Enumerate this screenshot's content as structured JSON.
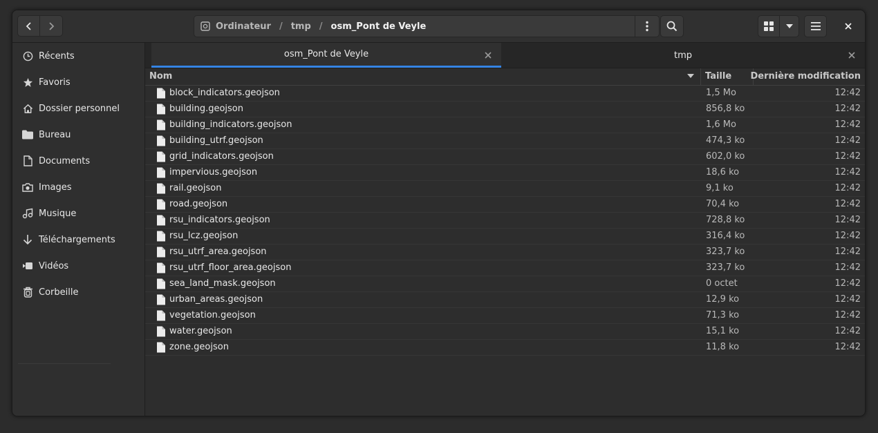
{
  "header": {
    "path_root": "Ordinateur",
    "path_segments": [
      "tmp",
      "osm_Pont de Veyle"
    ],
    "path_separator": "/"
  },
  "sidebar": {
    "items": [
      {
        "label": "Récents",
        "icon": "clock-icon"
      },
      {
        "label": "Favoris",
        "icon": "star-icon"
      },
      {
        "label": "Dossier personnel",
        "icon": "home-icon"
      },
      {
        "label": "Bureau",
        "icon": "folder-icon"
      },
      {
        "label": "Documents",
        "icon": "document-icon"
      },
      {
        "label": "Images",
        "icon": "camera-icon"
      },
      {
        "label": "Musique",
        "icon": "music-icon"
      },
      {
        "label": "Téléchargements",
        "icon": "download-icon"
      },
      {
        "label": "Vidéos",
        "icon": "video-icon"
      },
      {
        "label": "Corbeille",
        "icon": "trash-icon"
      }
    ]
  },
  "tabs": [
    {
      "label": "osm_Pont de Veyle",
      "active": true
    },
    {
      "label": "tmp",
      "active": false
    }
  ],
  "columns": {
    "name": "Nom",
    "size": "Taille",
    "modified": "Dernière modification"
  },
  "files": [
    {
      "name": "block_indicators.geojson",
      "size": "1,5 Mo",
      "modified": "12:42"
    },
    {
      "name": "building.geojson",
      "size": "856,8 ko",
      "modified": "12:42"
    },
    {
      "name": "building_indicators.geojson",
      "size": "1,6 Mo",
      "modified": "12:42"
    },
    {
      "name": "building_utrf.geojson",
      "size": "474,3 ko",
      "modified": "12:42"
    },
    {
      "name": "grid_indicators.geojson",
      "size": "602,0 ko",
      "modified": "12:42"
    },
    {
      "name": "impervious.geojson",
      "size": "18,6 ko",
      "modified": "12:42"
    },
    {
      "name": "rail.geojson",
      "size": "9,1 ko",
      "modified": "12:42"
    },
    {
      "name": "road.geojson",
      "size": "70,4 ko",
      "modified": "12:42"
    },
    {
      "name": "rsu_indicators.geojson",
      "size": "728,8 ko",
      "modified": "12:42"
    },
    {
      "name": "rsu_lcz.geojson",
      "size": "316,4 ko",
      "modified": "12:42"
    },
    {
      "name": "rsu_utrf_area.geojson",
      "size": "323,7 ko",
      "modified": "12:42"
    },
    {
      "name": "rsu_utrf_floor_area.geojson",
      "size": "323,7 ko",
      "modified": "12:42"
    },
    {
      "name": "sea_land_mask.geojson",
      "size": "0 octet",
      "modified": "12:42"
    },
    {
      "name": "urban_areas.geojson",
      "size": "12,9 ko",
      "modified": "12:42"
    },
    {
      "name": "vegetation.geojson",
      "size": "71,3 ko",
      "modified": "12:42"
    },
    {
      "name": "water.geojson",
      "size": "15,1 ko",
      "modified": "12:42"
    },
    {
      "name": "zone.geojson",
      "size": "11,8 ko",
      "modified": "12:42"
    }
  ],
  "colors": {
    "accent": "#3584e4",
    "window_bg": "#2d2d2d",
    "sidebar_bg": "#2f2f2f"
  }
}
